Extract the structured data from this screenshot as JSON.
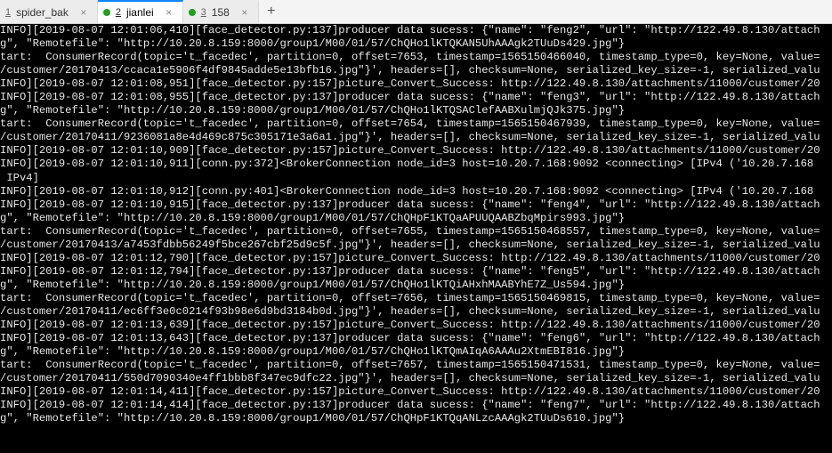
{
  "tabs": [
    {
      "index": "1",
      "label": "spider_bak",
      "dirty": false,
      "active": false,
      "closable": true
    },
    {
      "index": "2",
      "label": "jianlei",
      "dirty": true,
      "active": true,
      "closable": true
    },
    {
      "index": "3",
      "label": "158",
      "dirty": true,
      "active": false,
      "closable": true
    }
  ],
  "newtab_symbol": "+",
  "close_symbol": "×",
  "log_lines": [
    "INFO][2019-08-07 12:01:06,410][face_detector.py:137]producer data sucess: {\"name\": \"feng2\", \"url\": \"http://122.49.8.130/attach",
    "g\", \"Remotefile\": \"http://10.20.8.159:8000/group1/M00/01/57/ChQHo1lKTQKAN5UhAAAgk2TUuDs429.jpg\"}",
    "tart:  ConsumerRecord(topic='t_facedec', partition=0, offset=7653, timestamp=1565150466040, timestamp_type=0, key=None, value=",
    "/customer/20170413/ccaca1e5906f4df9845adde5e13bfb16.jpg\"}', headers=[], checksum=None, serialized_key_size=-1, serialized_valu",
    "INFO][2019-08-07 12:01:08,951][face_detector.py:157]picture_Convert_Success: http://122.49.8.130/attachments/11000/customer/20",
    "INFO][2019-08-07 12:01:08,955][face_detector.py:137]producer data sucess: {\"name\": \"feng3\", \"url\": \"http://122.49.8.130/attach",
    "g\", \"Remotefile\": \"http://10.20.8.159:8000/group1/M00/01/57/ChQHo1lKTQSAClefAABXulmjQJk375.jpg\"}",
    "tart:  ConsumerRecord(topic='t_facedec', partition=0, offset=7654, timestamp=1565150467939, timestamp_type=0, key=None, value=",
    "/customer/20170411/9236081a8e4d469c875c305171e3a6a1.jpg\"}', headers=[], checksum=None, serialized_key_size=-1, serialized_valu",
    "INFO][2019-08-07 12:01:10,909][face_detector.py:157]picture_Convert_Success: http://122.49.8.130/attachments/11000/customer/20",
    "INFO][2019-08-07 12:01:10,911][conn.py:372]<BrokerConnection node_id=3 host=10.20.7.168:9092 <connecting> [IPv4 ('10.20.7.168",
    " IPv4]",
    "INFO][2019-08-07 12:01:10,912][conn.py:401]<BrokerConnection node_id=3 host=10.20.7.168:9092 <connecting> [IPv4 ('10.20.7.168",
    "INFO][2019-08-07 12:01:10,915][face_detector.py:137]producer data sucess: {\"name\": \"feng4\", \"url\": \"http://122.49.8.130/attach",
    "g\", \"Remotefile\": \"http://10.20.8.159:8000/group1/M00/01/57/ChQHpF1KTQaAPUUQAABZbqMpirs993.jpg\"}",
    "tart:  ConsumerRecord(topic='t_facedec', partition=0, offset=7655, timestamp=1565150468557, timestamp_type=0, key=None, value=",
    "/customer/20170413/a7453fdbb56249f5bce267cbf25d9c5f.jpg\"}', headers=[], checksum=None, serialized_key_size=-1, serialized_valu",
    "INFO][2019-08-07 12:01:12,790][face_detector.py:157]picture_Convert_Success: http://122.49.8.130/attachments/11000/customer/20",
    "INFO][2019-08-07 12:01:12,794][face_detector.py:137]producer data sucess: {\"name\": \"feng5\", \"url\": \"http://122.49.8.130/attach",
    "g\", \"Remotefile\": \"http://10.20.8.159:8000/group1/M00/01/57/ChQHo1lKTQiAHxhMAABYhE7Z_Us594.jpg\"}",
    "tart:  ConsumerRecord(topic='t_facedec', partition=0, offset=7656, timestamp=1565150469815, timestamp_type=0, key=None, value=",
    "/customer/20170411/ec6ff3e0c0214f93b98e6d9bd3184b0d.jpg\"}', headers=[], checksum=None, serialized_key_size=-1, serialized_valu",
    "INFO][2019-08-07 12:01:13,639][face_detector.py:157]picture_Convert_Success: http://122.49.8.130/attachments/11000/customer/20",
    "INFO][2019-08-07 12:01:13,643][face_detector.py:137]producer data sucess: {\"name\": \"feng6\", \"url\": \"http://122.49.8.130/attach",
    "g\", \"Remotefile\": \"http://10.20.8.159:8000/group1/M00/01/57/ChQHo1lKTQmAIqA6AAAu2XtmEBI816.jpg\"}",
    "tart:  ConsumerRecord(topic='t_facedec', partition=0, offset=7657, timestamp=1565150471531, timestamp_type=0, key=None, value=",
    "/customer/20170411/550d7090340e4ff1bbb8f347ec9dfc22.jpg\"}', headers=[], checksum=None, serialized_key_size=-1, serialized_valu",
    "INFO][2019-08-07 12:01:14,411][face_detector.py:157]picture_Convert_Success: http://122.49.8.130/attachments/11000/customer/20",
    "INFO][2019-08-07 12:01:14,414][face_detector.py:137]producer data sucess: {\"name\": \"feng7\", \"url\": \"http://122.49.8.130/attach",
    "g\", \"Remotefile\": \"http://10.20.8.159:8000/group1/M00/01/57/ChQHpF1KTQqANLzcAAAgk2TUuDs610.jpg\"}"
  ]
}
